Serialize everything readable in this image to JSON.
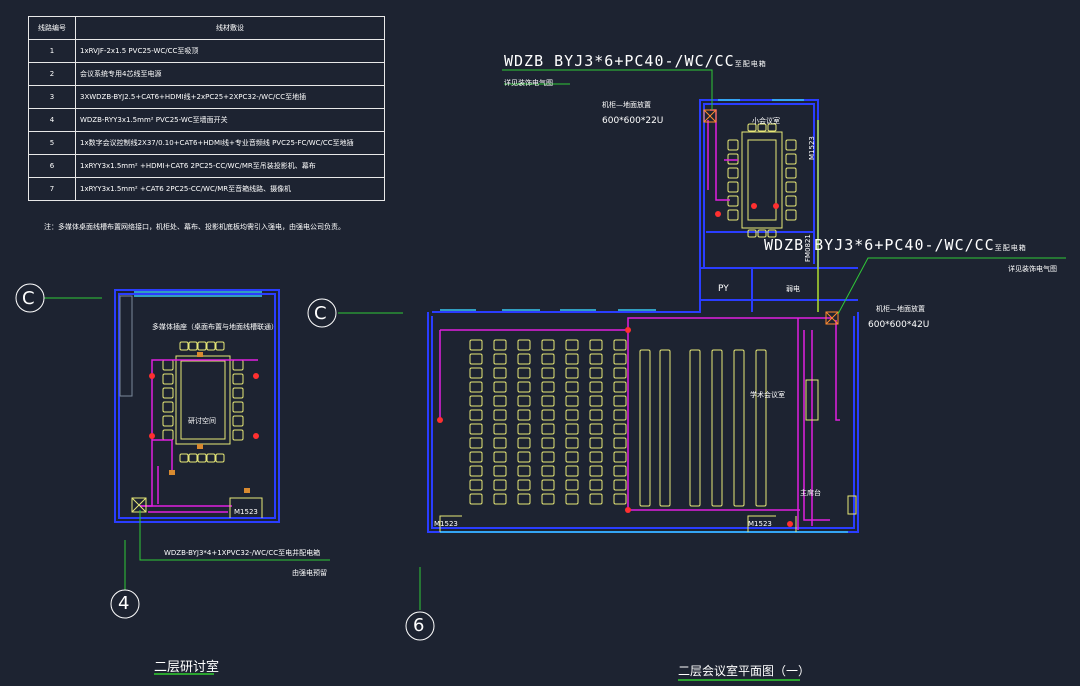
{
  "legend": {
    "headers": [
      "线路编号",
      "线材敷设"
    ],
    "rows": [
      {
        "no": "1",
        "desc": "1xRVJF-2x1.5 PVC25-WC/CC至吸顶"
      },
      {
        "no": "2",
        "desc": "会议系统专用4芯线至电源"
      },
      {
        "no": "3",
        "desc": "3XWDZB-BYJ2.5+CAT6+HDMI线+2xPC25+2XPC32-/WC/CC至地插"
      },
      {
        "no": "4",
        "desc": "WDZB-RYY3x1.5mm² PVC25-WC至墙面开关"
      },
      {
        "no": "5",
        "desc": "1x数字会议控制线2X37/0.10+CAT6+HDMI线+专业音频线 PVC25-FC/WC/CC至地插"
      },
      {
        "no": "6",
        "desc": "1xRYY3x1.5mm² +HDMI+CAT6 2PC25-CC/WC/MR至吊装投影机、幕布"
      },
      {
        "no": "7",
        "desc": "1xRYY3x1.5mm² +CAT6 2PC25-CC/WC/MR至音箱线路、摄像机"
      }
    ],
    "note": "注：多媒体桌面线槽布置网络接口，机柜处、幕布、投影机底板均需引入强电，由强电公司负责。"
  },
  "annotations": {
    "feed_top": "WDZB BYJ3*6+PC40-/WC/CC",
    "feed_top_suffix": "至配电箱",
    "feed_top_sub": "详见装饰电气图",
    "cabinet_top_label": "机柜—地面放置",
    "cabinet_top_size": "600*600*22U",
    "feed_mid": "WDZB BYJ3*6+PC40-/WC/CC",
    "feed_mid_suffix": "至配电箱",
    "feed_mid_sub": "详见装饰电气图",
    "cabinet_mid_label": "机柜—地面放置",
    "cabinet_mid_size": "600*600*42U",
    "feed_left": "WDZB-BYJ3*4+1XPVC32-/WC/CC至电井配电箱",
    "feed_left_sub": "由强电预留",
    "small_room": "小会议室",
    "lecture_room": "学术会议室",
    "control_room": "主席台",
    "study_room": "研讨空间",
    "study_room_note": "多媒体插座（桌面布置与地面线槽联通）",
    "py": "PY",
    "elec": "弱电",
    "door_fm": "FM0821",
    "door_m1": "M1523",
    "door_m2": "M1523",
    "door_m3": "M1523",
    "door_m4": "M1523",
    "axis_c1": "C",
    "axis_c2": "C",
    "axis_4": "4",
    "axis_6": "6",
    "title_left": "二层研讨室",
    "title_right": "二层会议室平面图（一）"
  },
  "colors": {
    "background": "#1d2331",
    "wall": "#2a3dff",
    "cable": "#e020e0",
    "furniture": "#e8e878",
    "window": "#38c8f0",
    "marker": "#ff3030",
    "axis": "#30c838",
    "title_underline": "#30d030"
  }
}
